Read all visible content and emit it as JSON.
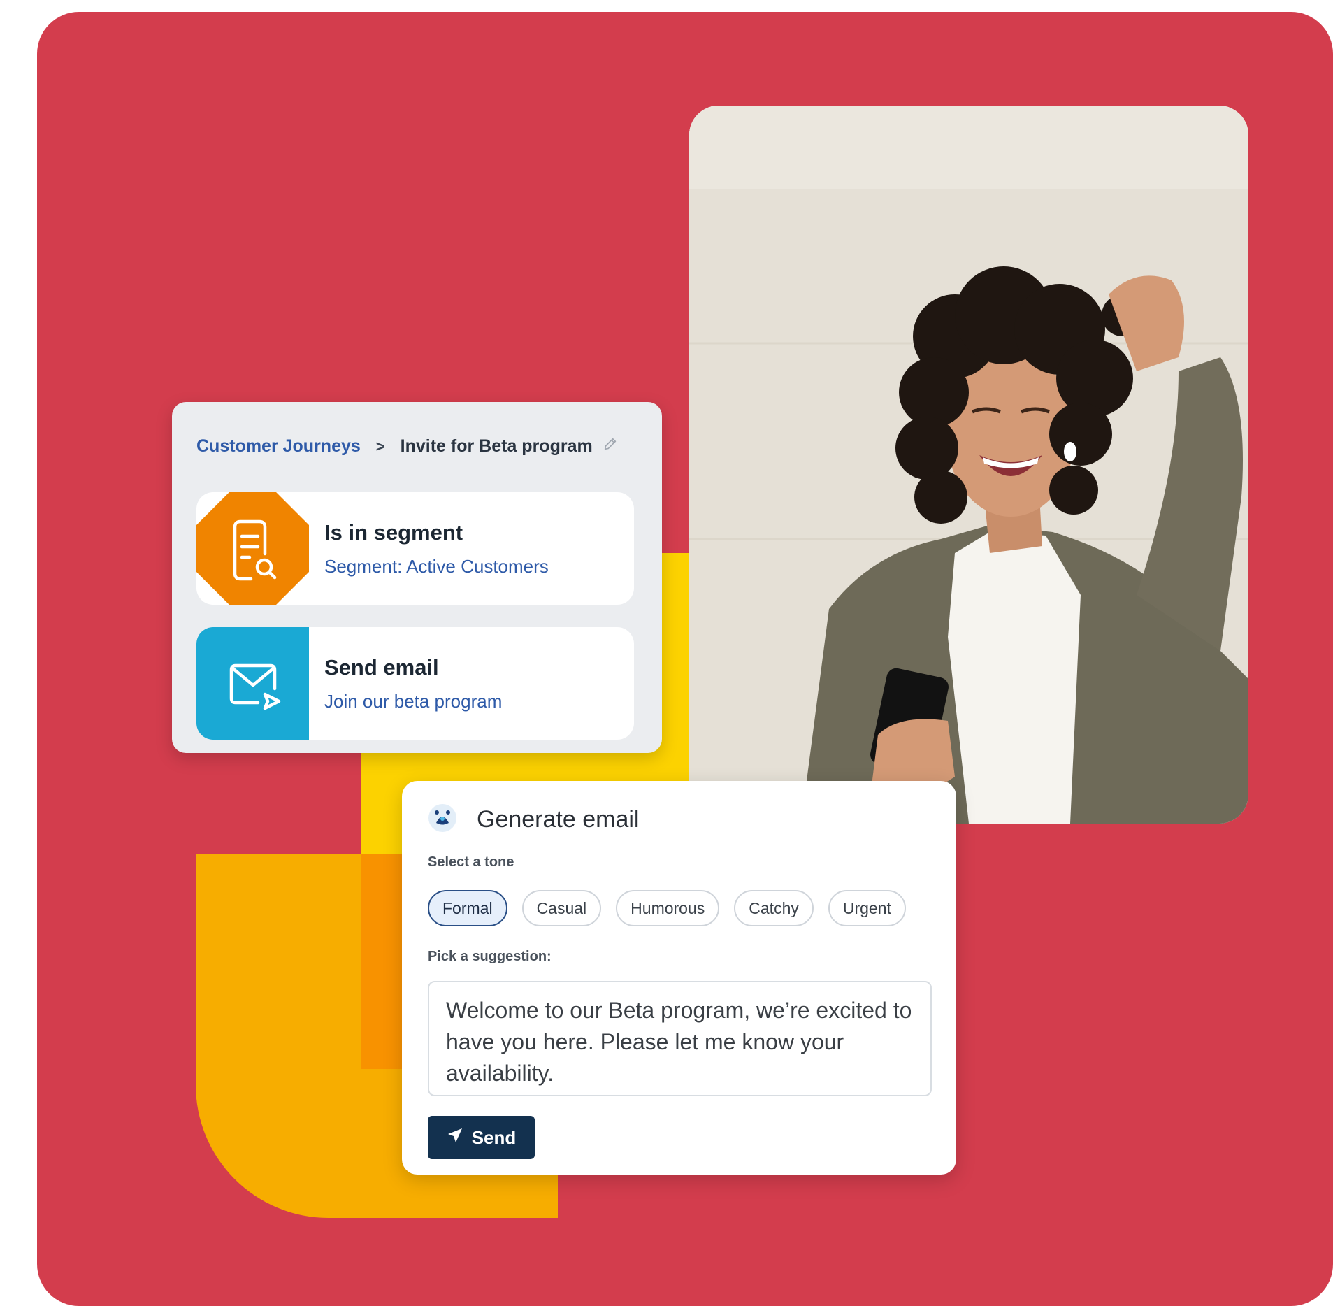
{
  "journey": {
    "breadcrumb": {
      "parent": "Customer Journeys",
      "separator": ">",
      "current": "Invite for Beta program",
      "edit_icon": "pencil-icon"
    },
    "steps": [
      {
        "title": "Is in segment",
        "subtitle": "Segment: Active Customers",
        "icon": "segment-search-icon",
        "icon_color": "#f08400"
      },
      {
        "title": "Send email",
        "subtitle": "Join our beta program",
        "icon": "email-send-icon",
        "icon_color": "#1aa9d4"
      }
    ]
  },
  "generate": {
    "title": "Generate email",
    "icon": "ai-assistant-icon",
    "tone_label": "Select a tone",
    "tones": [
      "Formal",
      "Casual",
      "Humorous",
      "Catchy",
      "Urgent"
    ],
    "selected_tone": "Formal",
    "suggestion_label": "Pick a suggestion:",
    "suggestion_text": "Welcome to our Beta program, we’re excited to have you here. Please let me know your availability.",
    "send_label": "Send",
    "send_icon": "paper-plane-icon"
  },
  "colors": {
    "background": "#d33d4d",
    "accent_yellow": "#fcd200",
    "accent_amber": "#f7ad00",
    "button_navy": "#13314f",
    "link_blue": "#2e5aa8"
  }
}
